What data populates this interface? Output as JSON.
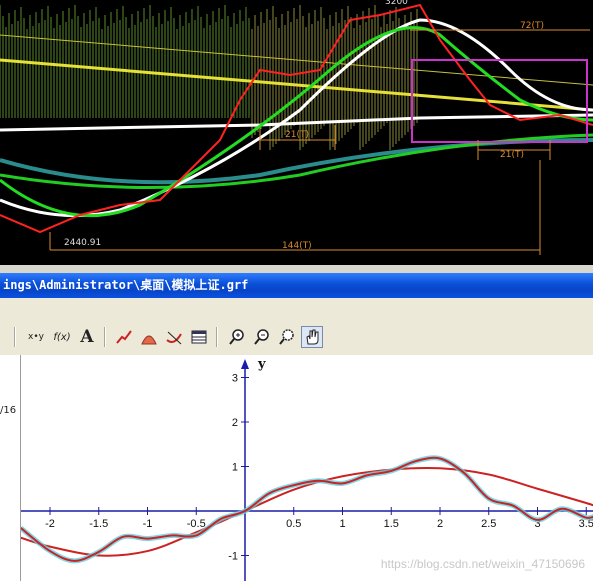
{
  "stock_chart": {
    "labels": {
      "top_price": "3200",
      "period_72": "72(T)",
      "period_21a": "21(T)",
      "period_21b": "21(T)",
      "period_144": "144(T)",
      "low_price": "2440.91"
    }
  },
  "window": {
    "title": "ings\\Administrator\\桌面\\模拟上证.grf"
  },
  "toolbar": {
    "items": [
      {
        "name": "xy-button",
        "label": "x•y"
      },
      {
        "name": "function-button",
        "label": "f(x)"
      },
      {
        "name": "text-button",
        "label": "A"
      },
      {
        "name": "curve-icon",
        "label": ""
      },
      {
        "name": "shade-icon",
        "label": ""
      },
      {
        "name": "tangent-icon",
        "label": ""
      },
      {
        "name": "table-icon",
        "label": ""
      },
      {
        "name": "zoom-in-icon",
        "label": ""
      },
      {
        "name": "zoom-out-icon",
        "label": ""
      },
      {
        "name": "zoom-fit-icon",
        "label": ""
      },
      {
        "name": "hand-icon",
        "label": ""
      }
    ]
  },
  "side_panel": {
    "text": "/16"
  },
  "chart_data": {
    "type": "line",
    "title": "",
    "xlabel": "",
    "ylabel": "y",
    "xlim": [
      -2.35,
      3.6
    ],
    "ylim": [
      -1.2,
      3.3
    ],
    "x_ticks": [
      "-2",
      "-1.5",
      "-1",
      "-0.5",
      "0.5",
      "1",
      "1.5",
      "2",
      "2.5",
      "3",
      "3.5"
    ],
    "y_ticks": [
      "3",
      "2",
      "1",
      "-1"
    ],
    "grid": false,
    "series": [
      {
        "color": "#cc2222",
        "x": [
          -2.3,
          -2.0,
          -1.5,
          -1.0,
          -0.5,
          0.0,
          0.5,
          1.0,
          1.5,
          2.0,
          2.5,
          3.0,
          3.5,
          3.6
        ],
        "y": [
          -0.6,
          -0.8,
          -1.0,
          -0.9,
          -0.48,
          0.0,
          0.48,
          0.78,
          0.93,
          0.96,
          0.82,
          0.5,
          0.18,
          0.1
        ]
      },
      {
        "color": "#cc2222",
        "x": [
          -2.3,
          -2.0,
          -1.75,
          -1.5,
          -1.25,
          -1.0,
          -0.75,
          -0.5,
          -0.25,
          0.0,
          0.25,
          0.5,
          0.75,
          1.0,
          1.25,
          1.5,
          1.75,
          2.0,
          2.25,
          2.5,
          2.75,
          3.0,
          3.25,
          3.5,
          3.6
        ],
        "y": [
          -0.38,
          -0.9,
          -1.12,
          -0.92,
          -0.58,
          -0.62,
          -0.55,
          -0.55,
          -0.18,
          0.0,
          0.4,
          0.58,
          0.68,
          0.62,
          0.8,
          0.9,
          1.12,
          1.18,
          0.85,
          0.28,
          0.12,
          -0.2,
          0.05,
          -0.15,
          -0.1
        ]
      }
    ]
  }
}
